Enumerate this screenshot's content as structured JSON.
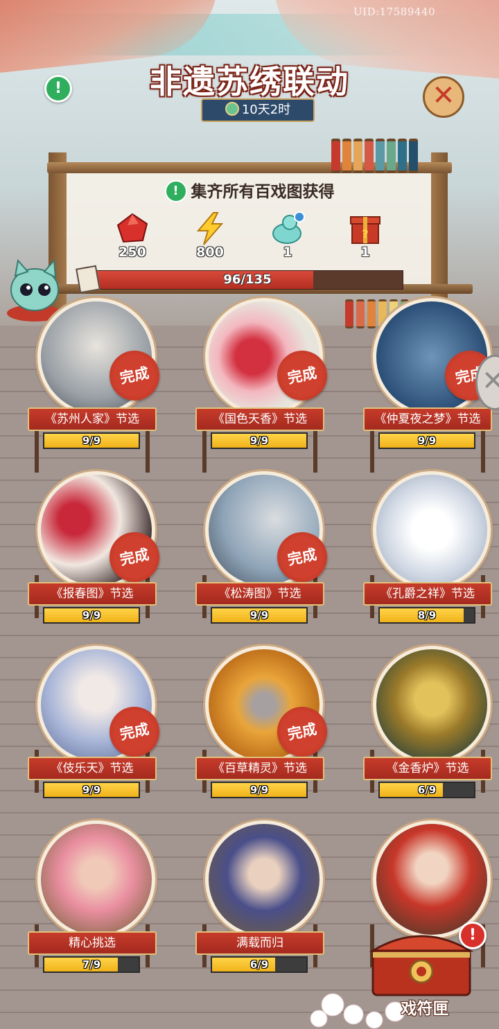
{
  "header": {
    "uid": "UID:17589440",
    "title": "非遗苏绣联动",
    "timer": "10天2时"
  },
  "collect": {
    "text": "集齐所有百戏图获得",
    "rewards": [
      {
        "icon": "red-gem-icon",
        "count": "250"
      },
      {
        "icon": "lightning-icon",
        "count": "800"
      },
      {
        "icon": "jade-gourd-icon",
        "count": "1"
      },
      {
        "icon": "mystery-box-icon",
        "count": "1"
      }
    ],
    "progress_text": "96/135",
    "progress_fraction": 0.711
  },
  "complete_label": "完成",
  "cards": [
    {
      "label": "《苏州人家》节选",
      "progress": "9/9",
      "fraction": 1.0,
      "done": true,
      "pic": "sketch"
    },
    {
      "label": "《国色天香》节选",
      "progress": "9/9",
      "fraction": 1.0,
      "done": true,
      "pic": "peony"
    },
    {
      "label": "《仲夏夜之梦》节选",
      "progress": "9/9",
      "fraction": 1.0,
      "done": true,
      "pic": "blue"
    },
    {
      "label": "《报春图》节选",
      "progress": "9/9",
      "fraction": 1.0,
      "done": true,
      "pic": "plum"
    },
    {
      "label": "《松涛图》节选",
      "progress": "9/9",
      "fraction": 1.0,
      "done": true,
      "pic": "pine"
    },
    {
      "label": "《孔爵之祥》节选",
      "progress": "8/9",
      "fraction": 0.889,
      "done": false,
      "pic": "peacock"
    },
    {
      "label": "《伎乐天》节选",
      "progress": "9/9",
      "fraction": 1.0,
      "done": true,
      "pic": "apsara"
    },
    {
      "label": "《百草精灵》节选",
      "progress": "9/9",
      "fraction": 1.0,
      "done": true,
      "pic": "monkey"
    },
    {
      "label": "《金香炉》节选",
      "progress": "6/9",
      "fraction": 0.667,
      "done": false,
      "pic": "censer"
    },
    {
      "label": "精心挑选",
      "progress": "7/9",
      "fraction": 0.778,
      "done": false,
      "pic": "lady"
    },
    {
      "label": "满载而归",
      "progress": "6/9",
      "fraction": 0.667,
      "done": false,
      "pic": "man"
    },
    {
      "label": "",
      "progress": "",
      "fraction": 0,
      "done": false,
      "pic": "lady2"
    }
  ],
  "chest": {
    "label": "戏符匣"
  },
  "colors": {
    "accent_red": "#c63b2a",
    "gold": "#f0b21a",
    "green": "#2fae5e"
  }
}
